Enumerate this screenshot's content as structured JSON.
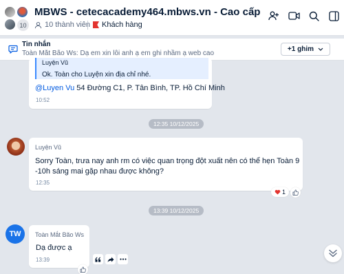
{
  "header": {
    "title": "MBWS - cetecacademy464.mbws.vn - Cao cấp",
    "avatar_count": "10",
    "members": "10 thành viên",
    "tag": "Khách hàng"
  },
  "pinned": {
    "title": "Tin nhắn",
    "text": "Toàn Mắt Bão Ws: Dạ em xin lỗi anh ạ em ghi nhầm ạ web cao cấp ạ",
    "button": "+1 ghim"
  },
  "messages": [
    {
      "quote_name": "Luyện Vũ",
      "quote_text": "Ok. Toàn cho Luyện xin địa chỉ nhé.",
      "mention": "@Luyen Vu",
      "text": " 54 Đường C1, P. Tân Bình, TP. Hồ Chí Minh",
      "time": "10:52"
    },
    {
      "sender": "Luyện Vũ",
      "text": "Sorry Toàn, trưa nay anh rm có việc quan trọng đột xuất nên có thể hẹn Toàn 9 -10h sáng mai gặp nhau được không?",
      "time": "12:35",
      "reaction_count": "1"
    },
    {
      "avatar_initials": "TW",
      "sender": "Toàn Mắt Bão Ws",
      "text": "Dạ được ạ",
      "time": "13:39"
    }
  ],
  "date_separators": [
    "12:35 10/12/2025",
    "13:39 10/12/2025"
  ],
  "colors": {
    "accent": "#005ae0",
    "tag_red": "#e3342f",
    "avatar_blue": "#1a73e8"
  }
}
